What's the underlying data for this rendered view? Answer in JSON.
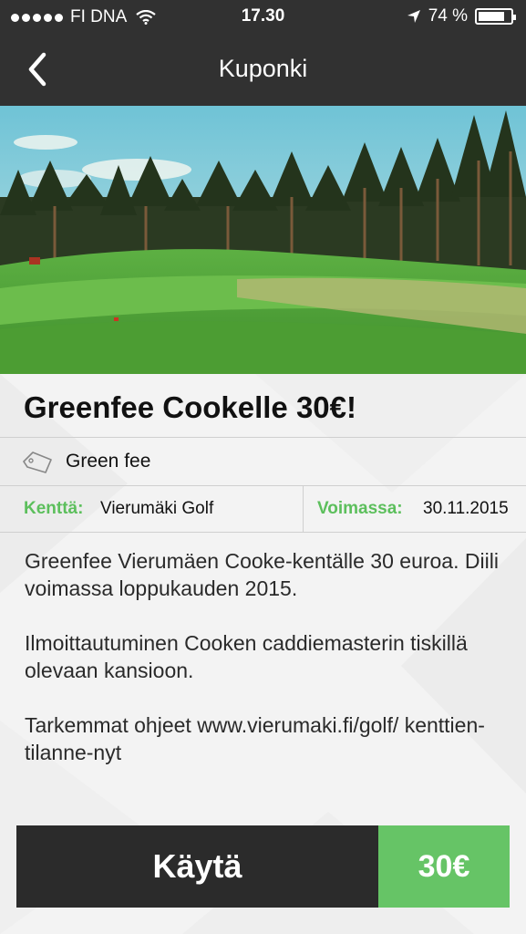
{
  "status_bar": {
    "carrier": "FI DNA",
    "time": "17.30",
    "battery": "74 %",
    "battery_level": 0.74,
    "icons": [
      "signal-dots-icon",
      "wifi-icon",
      "location-arrow-icon",
      "battery-icon"
    ]
  },
  "nav": {
    "title": "Kuponki",
    "back_icon": "chevron-left-icon"
  },
  "hero": {
    "image": "golf-course-photo"
  },
  "coupon": {
    "title": "Greenfee Cookelle 30€!",
    "category": "Green fee",
    "category_icon": "tag-icon",
    "course_label": "Kenttä:",
    "course_value": "Vierumäki Golf",
    "valid_label": "Voimassa:",
    "valid_value": "30.11.2015",
    "description": [
      "Greenfee Vierumäen Cooke-kentälle 30 euroa. Diili voimassa loppukauden 2015.",
      "Ilmoittautuminen Cooken caddiemasterin tiskillä olevaan kansioon.",
      "Tarkemmat ohjeet www.vierumaki.fi/golf/ kenttien-tilanne-nyt"
    ]
  },
  "actions": {
    "use_label": "Käytä",
    "price": "30€"
  },
  "colors": {
    "bar": "#313131",
    "accent_green": "#5cbf5c",
    "price_green": "#66c466",
    "button_dark": "#2b2b2b"
  }
}
